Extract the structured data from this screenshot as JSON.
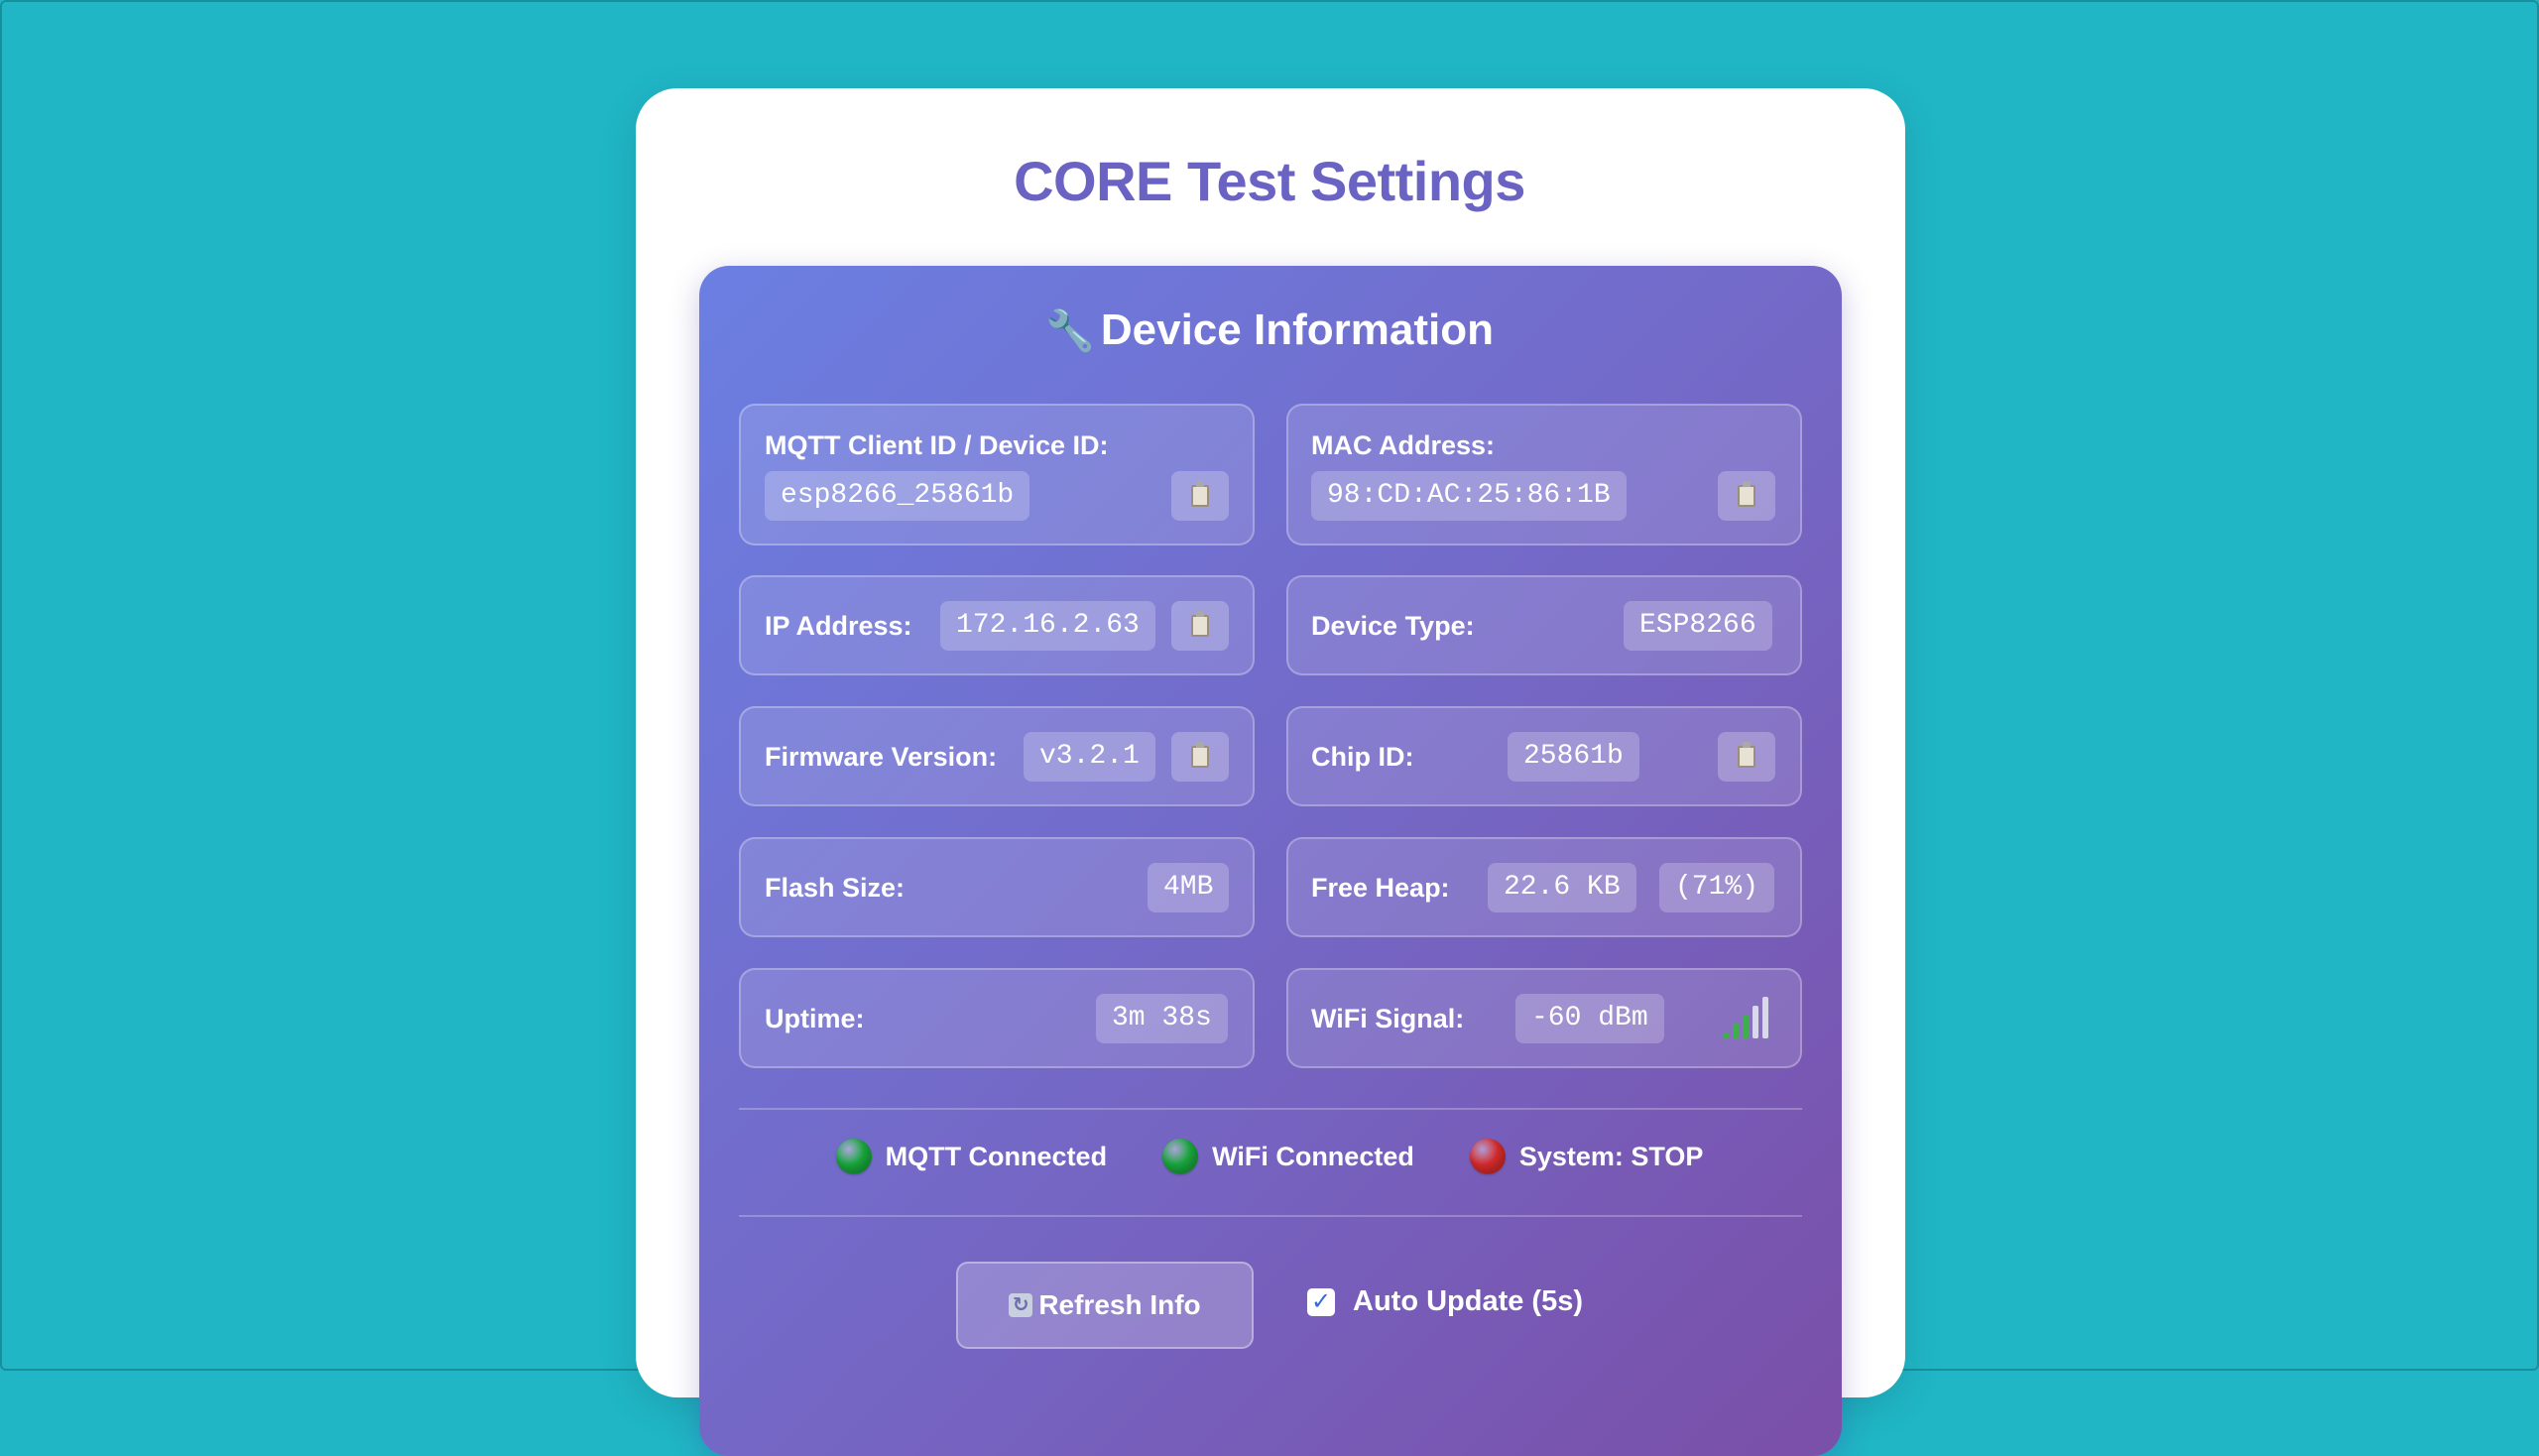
{
  "page": {
    "title": "CORE Test Settings"
  },
  "panel": {
    "title": "Device Information",
    "title_icon": "wrench-icon"
  },
  "fields": {
    "mqtt_client_id": {
      "label": "MQTT Client ID / Device ID:",
      "value": "esp8266_25861b"
    },
    "mac_address": {
      "label": "MAC Address:",
      "value": "98:CD:AC:25:86:1B"
    },
    "ip_address": {
      "label": "IP Address:",
      "value": "172.16.2.63"
    },
    "device_type": {
      "label": "Device Type:",
      "value": "ESP8266"
    },
    "firmware_version": {
      "label": "Firmware Version:",
      "value": "v3.2.1"
    },
    "chip_id": {
      "label": "Chip ID:",
      "value": "25861b"
    },
    "flash_size": {
      "label": "Flash Size:",
      "value": "4MB"
    },
    "free_heap": {
      "label": "Free Heap:",
      "value": "22.6 KB",
      "percent": "(71%)"
    },
    "uptime": {
      "label": "Uptime:",
      "value": "3m 38s"
    },
    "wifi_signal": {
      "label": "WiFi Signal:",
      "value": "-60 dBm",
      "bars_active": 3,
      "bars_total": 5
    }
  },
  "status": [
    {
      "label": "MQTT Connected",
      "state": "ok",
      "color": "#19a93c"
    },
    {
      "label": "WiFi Connected",
      "state": "ok",
      "color": "#19a93c"
    },
    {
      "label": "System: STOP",
      "state": "stopped",
      "color": "#d92b2b"
    }
  ],
  "actions": {
    "refresh_label": "Refresh Info",
    "auto_update_label": "Auto Update (5s)",
    "auto_update_checked": true
  },
  "colors": {
    "background": "#20b6c6",
    "title": "#6a63c4",
    "signal_active": "#3db04b",
    "signal_inactive": "#d9d9ec"
  }
}
